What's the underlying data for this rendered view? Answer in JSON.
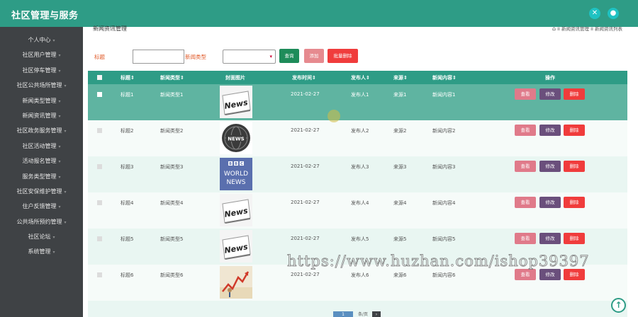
{
  "app": {
    "title": "社区管理与服务"
  },
  "header_icons": [
    "fullscreen-icon",
    "user-icon"
  ],
  "sidebar": {
    "items": [
      {
        "label": "个人中心"
      },
      {
        "label": "社区用户管理"
      },
      {
        "label": "社区停车管理"
      },
      {
        "label": "社区公共场所管理"
      },
      {
        "label": "新闻类型管理"
      },
      {
        "label": "新闻资讯管理"
      },
      {
        "label": "社区政务服务管理"
      },
      {
        "label": "社区活动管理"
      },
      {
        "label": "活动报名管理"
      },
      {
        "label": "服务类型管理"
      },
      {
        "label": "社区安保维护管理"
      },
      {
        "label": "住户反馈管理"
      },
      {
        "label": "公共场所预约管理"
      },
      {
        "label": "社区论坛"
      },
      {
        "label": "系统管理"
      }
    ]
  },
  "page": {
    "title": "新闻资讯管理",
    "breadcrumb": [
      "新闻资讯管理",
      "新闻资讯列表"
    ]
  },
  "search": {
    "title_label": "标题",
    "title_value": "",
    "type_label": "新闻类型",
    "type_value": "",
    "query_button": "查询",
    "add_button": "添加",
    "batch_delete_button": "批量删除"
  },
  "table": {
    "headers": [
      "标题⇕",
      "新闻类型⇕",
      "封面图片",
      "发布时间⇕",
      "发布人⇕",
      "来源⇕",
      "新闻内容⇕",
      "操作"
    ],
    "action_labels": {
      "view": "查看",
      "edit": "修改",
      "delete": "删除"
    },
    "rows": [
      {
        "title": "标题1",
        "type": "新闻类型1",
        "cover": "news-paper",
        "time": "2021-02-27",
        "publisher": "发布人1",
        "source": "来源1",
        "content": "新闻内容1"
      },
      {
        "title": "标题2",
        "type": "新闻类型2",
        "cover": "news-globe",
        "time": "2021-02-27",
        "publisher": "发布人2",
        "source": "来源2",
        "content": "新闻内容2"
      },
      {
        "title": "标题3",
        "type": "新闻类型3",
        "cover": "bbc-world-news",
        "time": "2021-02-27",
        "publisher": "发布人3",
        "source": "来源3",
        "content": "新闻内容3"
      },
      {
        "title": "标题4",
        "type": "新闻类型4",
        "cover": "news-paper",
        "time": "2021-02-27",
        "publisher": "发布人4",
        "source": "来源4",
        "content": "新闻内容4"
      },
      {
        "title": "标题5",
        "type": "新闻类型5",
        "cover": "news-paper",
        "time": "2021-02-27",
        "publisher": "发布人5",
        "source": "来源5",
        "content": "新闻内容5"
      },
      {
        "title": "标题6",
        "type": "新闻类型6",
        "cover": "stock-chart",
        "time": "2021-02-27",
        "publisher": "发布人6",
        "source": "来源6",
        "content": "新闻内容6"
      }
    ]
  },
  "bbc_logo": {
    "line1": "BBC",
    "line2": "WORLD",
    "line3": "NEWS"
  },
  "news_logo_text": "News",
  "pagination": {
    "current_page": "1",
    "per_page_label": "条/页"
  },
  "watermark": "https://www.huzhan.com/ishop39397",
  "colors": {
    "primary": "#2e9c86",
    "view": "#e07a8a",
    "edit": "#6a4f7c",
    "delete": "#f03c3c"
  }
}
